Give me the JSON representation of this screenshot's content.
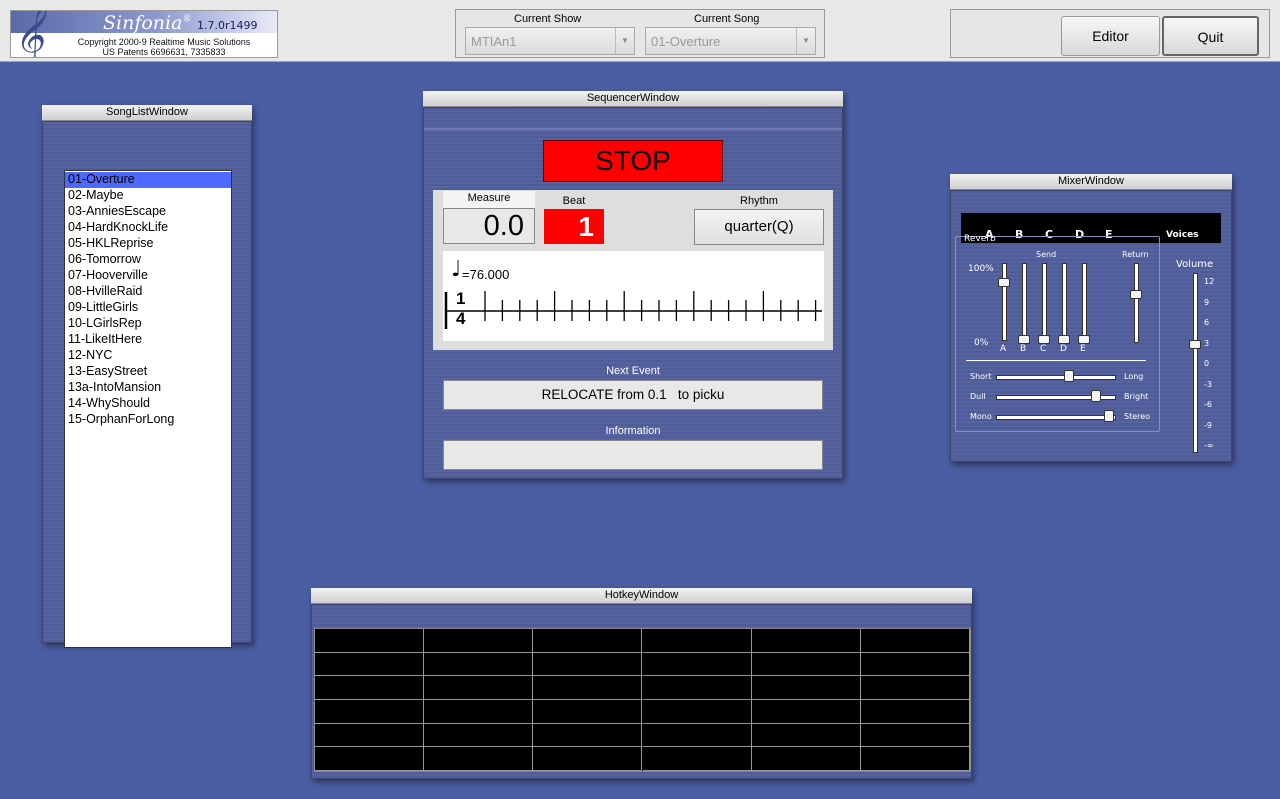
{
  "logo": {
    "name": "Sinfonia",
    "registered": "®",
    "version": "1.7.0r1499",
    "copyright": "Copyright 2000-9 Realtime Music Solutions",
    "patents": "US Patents 6696631, 7335833"
  },
  "show_selector": {
    "show_label": "Current Show",
    "show_value": "MTIAn1",
    "song_label": "Current Song",
    "song_value": "01-Overture"
  },
  "toolbar": {
    "editor_label": "Editor",
    "quit_label": "Quit"
  },
  "song_list_window": {
    "title": "SongListWindow",
    "songs": [
      "01-Overture",
      "02-Maybe",
      "03-AnniesEscape",
      "04-HardKnockLife",
      "05-HKLReprise",
      "06-Tomorrow",
      "07-Hooverville",
      "08-HvilleRaid",
      "09-LittleGirls",
      "10-LGirlsRep",
      "11-LikeItHere",
      "12-NYC",
      "13-EasyStreet",
      "13a-IntoMansion",
      "14-WhyShould",
      "15-OrphanForLong"
    ],
    "selected": "01-Overture"
  },
  "sequencer_window": {
    "title": "SequencerWindow",
    "stop_label": "STOP",
    "measure_label": "Measure",
    "measure_value": "0.0",
    "beat_label": "Beat",
    "beat_value": "1",
    "rhythm_label": "Rhythm",
    "rhythm_value": "quarter(Q)",
    "tempo": "=76.000",
    "time_signature_top": "1",
    "time_signature_bottom": "4",
    "next_event_label": "Next Event",
    "next_event_value": "RELOCATE from 0.1   to picku",
    "information_label": "Information",
    "information_value": ""
  },
  "mixer_window": {
    "title": "MixerWindow",
    "voices": [
      "A",
      "B",
      "C",
      "D",
      "E"
    ],
    "voices_label": "Voices",
    "reverb_label": "Reverb",
    "send_label": "Send",
    "return_label": "Return",
    "volume_label": "Volume",
    "pct_max": "100%",
    "pct_min": "0%",
    "send_channels": [
      "A",
      "B",
      "C",
      "D",
      "E"
    ],
    "send_levels": [
      0.75,
      0.0,
      0.0,
      0.0,
      0.0
    ],
    "return_level": 0.6,
    "volume_scale": [
      "12",
      "9",
      "6",
      "3",
      "0",
      "-3",
      "-6",
      "-9",
      "-∞"
    ],
    "volume_level_db": 3,
    "tone_controls": [
      {
        "left": "Short",
        "right": "Long",
        "level": 0.62
      },
      {
        "left": "Dull",
        "right": "Bright",
        "level": 0.85
      },
      {
        "left": "Mono",
        "right": "Stereo",
        "level": 0.96
      }
    ]
  },
  "hotkey_window": {
    "title": "HotkeyWindow",
    "rows": 6,
    "columns": 6
  },
  "colors": {
    "desktop": "#4b5ea3",
    "stop_red": "#ff0000",
    "selection": "#4d69ff"
  }
}
